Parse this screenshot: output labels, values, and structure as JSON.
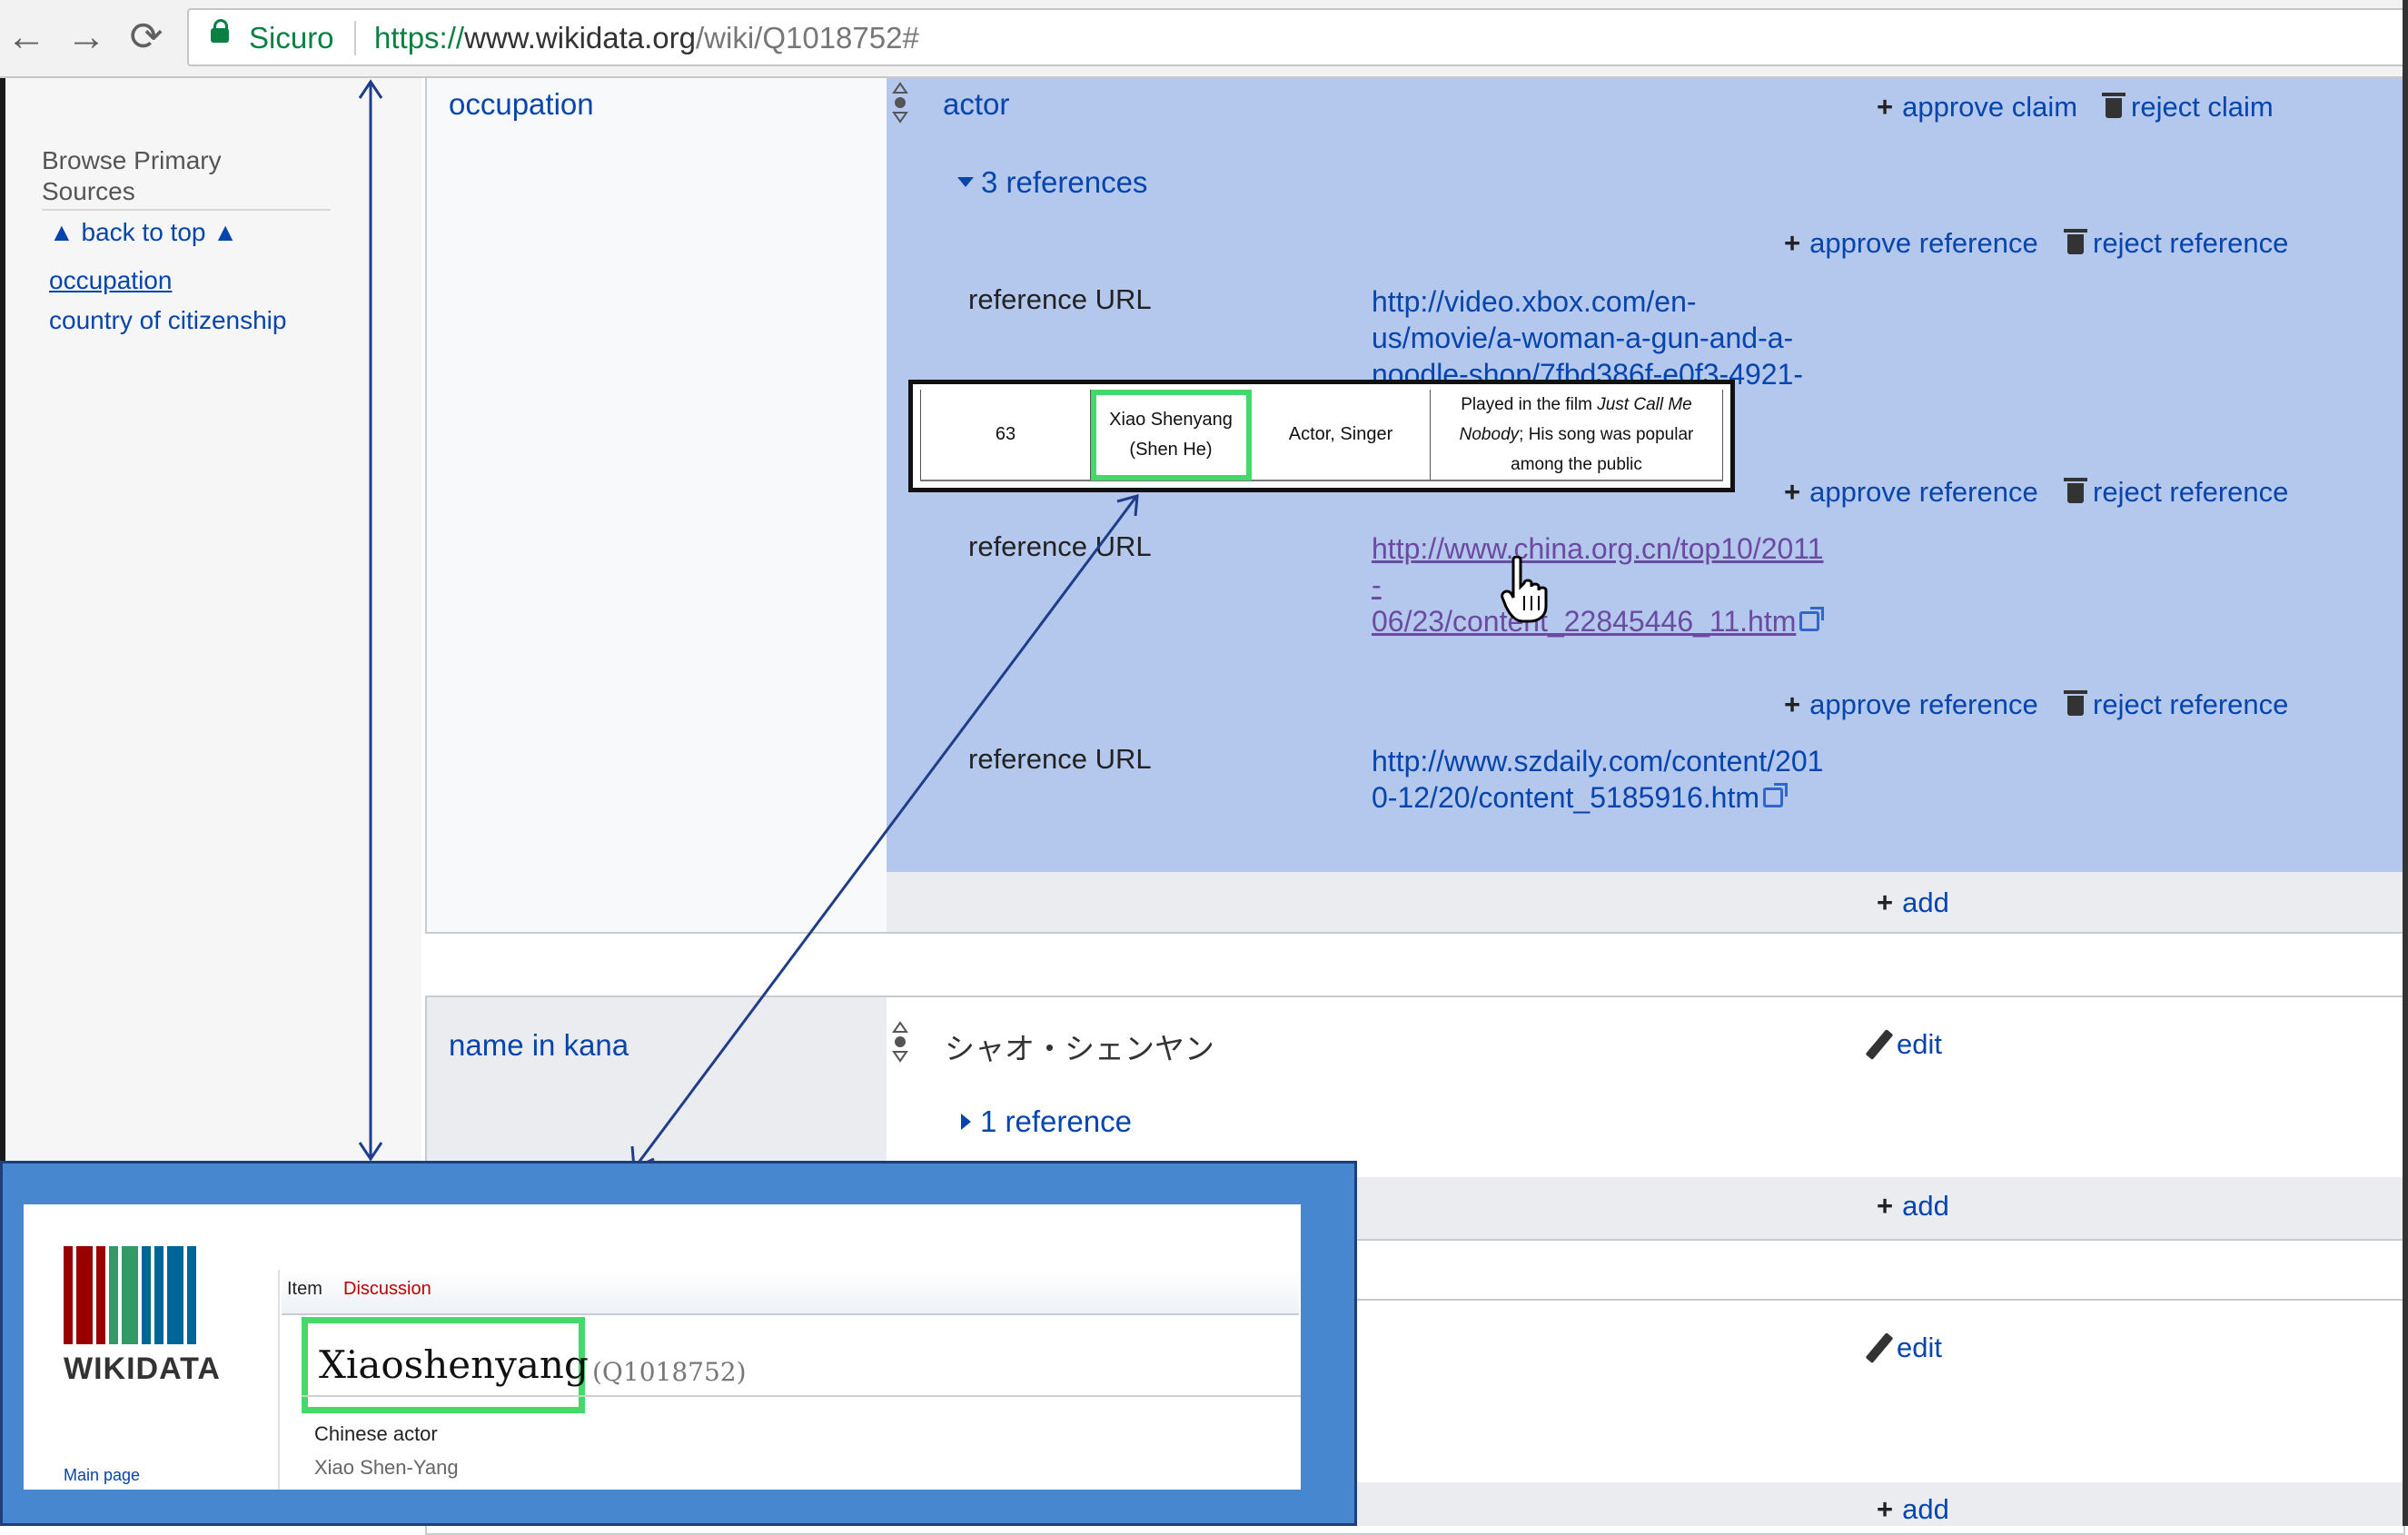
{
  "browser": {
    "back": "←",
    "forward": "→",
    "reload": "⟳",
    "secure_label": "Sicuro",
    "url_protocol": "https://",
    "url_host": "www.wikidata.org",
    "url_path": "/wiki/Q1018752#"
  },
  "sidebar": {
    "heading": "Browse Primary Sources",
    "back_to_top": "▲ back to top ▲",
    "items": [
      {
        "label": "occupation"
      },
      {
        "label": "country of citizenship"
      }
    ]
  },
  "occupation": {
    "property": "occupation",
    "value": "actor",
    "approve_claim": "approve claim",
    "reject_claim": "reject claim",
    "references_toggle": "3 references",
    "references": [
      {
        "approve": "approve reference",
        "reject": "reject reference",
        "label": "reference URL",
        "url_lines": [
          "http://video.xbox.com/en-",
          "us/movie/a-woman-a-gun-and-a-",
          "noodle-shop/7fbd386f-e0f3-4921-"
        ]
      },
      {
        "approve": "approve reference",
        "reject": "reject reference",
        "label": "reference URL",
        "url_lines": [
          "http://www.china.org.cn/top10/2011",
          "-",
          "06/23/content_22845446_11.htm"
        ]
      },
      {
        "approve": "approve reference",
        "reject": "reject reference",
        "label": "reference URL",
        "url_lines": [
          "http://www.szdaily.com/content/201",
          "0-12/20/content_5185916.htm"
        ]
      }
    ],
    "add": "add"
  },
  "name_in_kana": {
    "property": "name in kana",
    "value": "シャオ・シェンヤン",
    "edit": "edit",
    "references_toggle": "1 reference",
    "add": "add"
  },
  "third_group": {
    "edit": "edit",
    "add": "add"
  },
  "table_clip": {
    "cells": [
      "63",
      "Xiao Shenyang",
      "(Shen He)",
      "Actor, Singer",
      "Played in the film ",
      "Just Call Me Nobody",
      "; His song was popular among the public"
    ]
  },
  "wikidata_card": {
    "logo_text": "WIKIDATA",
    "main_page": "Main page",
    "tab_item": "Item",
    "tab_discussion": "Discussion",
    "title": "Xiaoshenyang",
    "qid": "(Q1018752)",
    "description": "Chinese actor",
    "alias": "Xiao Shen-Yang"
  },
  "colors": {
    "highlight_green": "#43d96b",
    "claim_blue": "#b4c7ec",
    "overlay_blue": "#4787d0",
    "link": "#0645ad",
    "visited_link": "#6b4ba1",
    "arrow": "#1f3d8a"
  },
  "logo_bar_colors": [
    "#990000",
    "#990000",
    "#990000",
    "#339966",
    "#339966",
    "#006699",
    "#006699",
    "#006699",
    "#006699"
  ]
}
